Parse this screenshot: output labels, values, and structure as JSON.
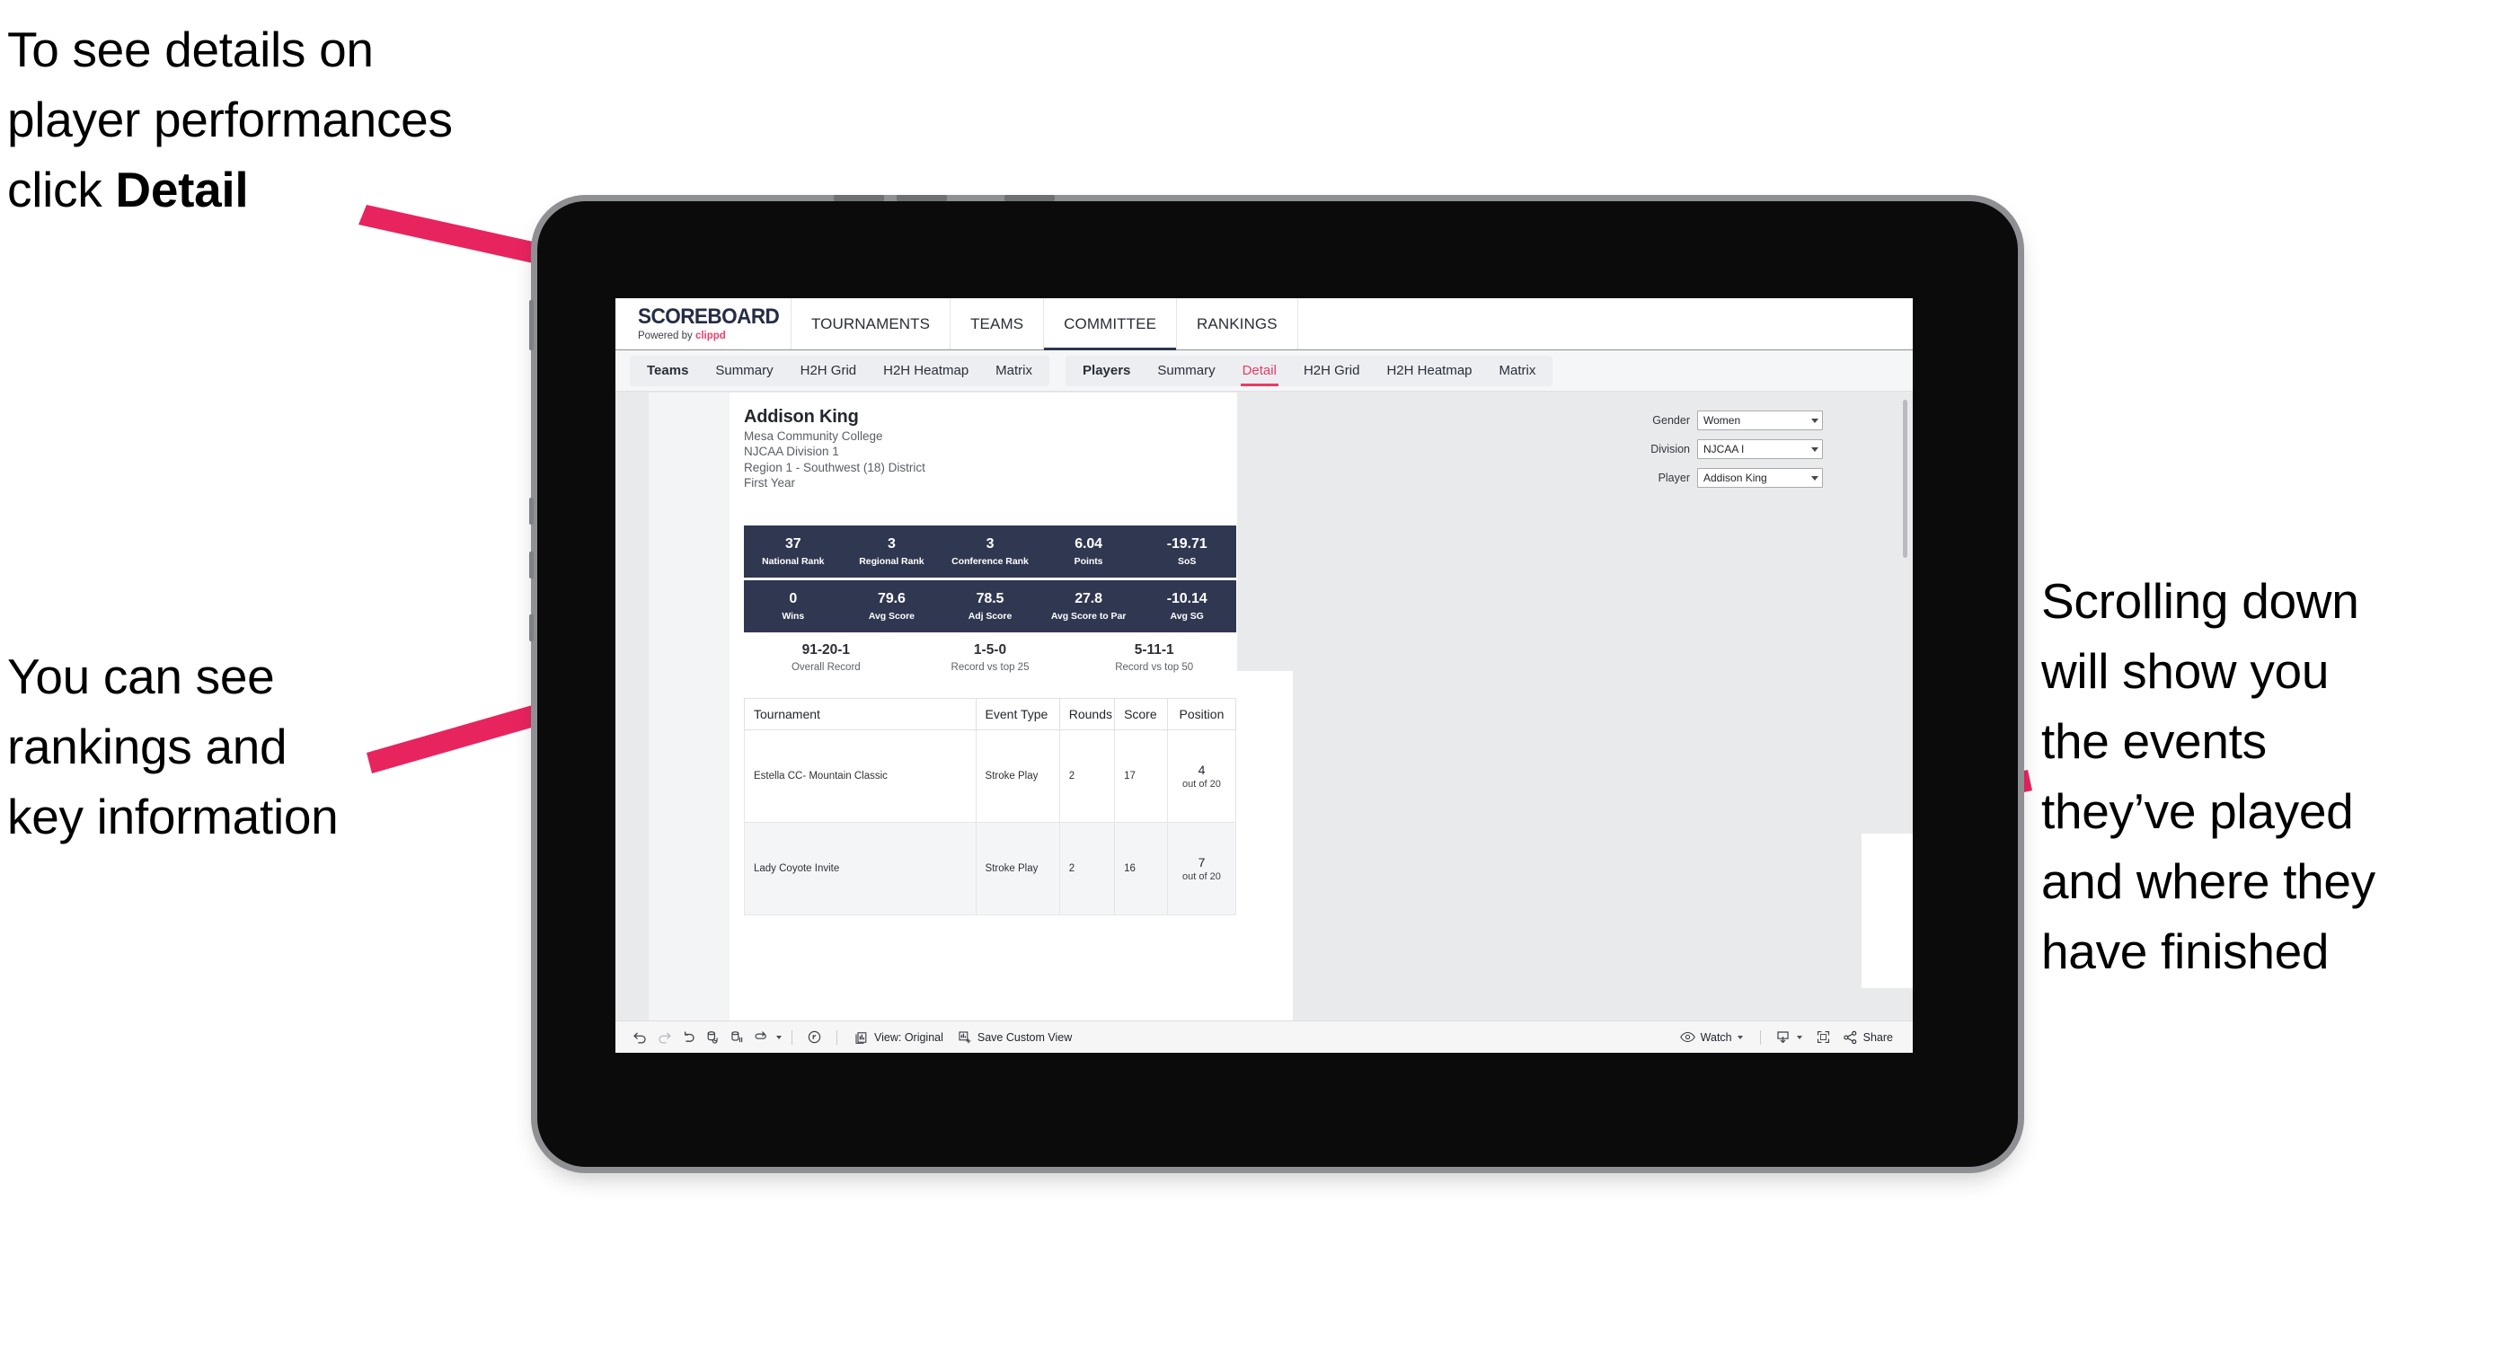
{
  "annotations": {
    "detail": "To see details on\nplayer performances\nclick ",
    "detail_bold": "Detail",
    "rankings": "You can see\nrankings and\nkey information",
    "scroll": "Scrolling down\nwill show you\nthe events\nthey’ve played\nand where they\nhave finished"
  },
  "brand": {
    "name": "SCOREBOARD",
    "tagline_prefix": "Powered by ",
    "tagline_brand": "clippd"
  },
  "topnav": {
    "items": [
      {
        "label": "TOURNAMENTS",
        "active": false
      },
      {
        "label": "TEAMS",
        "active": false
      },
      {
        "label": "COMMITTEE",
        "active": true
      },
      {
        "label": "RANKINGS",
        "active": false
      }
    ]
  },
  "subnav": {
    "group_teams": [
      {
        "label": "Teams",
        "bold": true,
        "active": false
      },
      {
        "label": "Summary",
        "bold": false,
        "active": false
      },
      {
        "label": "H2H Grid",
        "bold": false,
        "active": false
      },
      {
        "label": "H2H Heatmap",
        "bold": false,
        "active": false
      },
      {
        "label": "Matrix",
        "bold": false,
        "active": false
      }
    ],
    "group_players": [
      {
        "label": "Players",
        "bold": true,
        "active": false
      },
      {
        "label": "Summary",
        "bold": false,
        "active": false
      },
      {
        "label": "Detail",
        "bold": false,
        "active": true
      },
      {
        "label": "H2H Grid",
        "bold": false,
        "active": false
      },
      {
        "label": "H2H Heatmap",
        "bold": false,
        "active": false
      },
      {
        "label": "Matrix",
        "bold": false,
        "active": false
      }
    ]
  },
  "player": {
    "name": "Addison King",
    "school": "Mesa Community College",
    "division": "NJCAA Division 1",
    "region": "Region 1 - Southwest (18) District",
    "year": "First Year"
  },
  "filters": [
    {
      "label": "Gender",
      "value": "Women"
    },
    {
      "label": "Division",
      "value": "NJCAA I"
    },
    {
      "label": "Player",
      "value": "Addison King"
    }
  ],
  "stats_row1": [
    {
      "value": "37",
      "label": "National Rank"
    },
    {
      "value": "3",
      "label": "Regional Rank"
    },
    {
      "value": "3",
      "label": "Conference Rank"
    },
    {
      "value": "6.04",
      "label": "Points"
    },
    {
      "value": "-19.71",
      "label": "SoS"
    }
  ],
  "stats_row2": [
    {
      "value": "0",
      "label": "Wins"
    },
    {
      "value": "79.6",
      "label": "Avg Score"
    },
    {
      "value": "78.5",
      "label": "Adj Score"
    },
    {
      "value": "27.8",
      "label": "Avg Score to Par"
    },
    {
      "value": "-10.14",
      "label": "Avg SG"
    }
  ],
  "records": [
    {
      "value": "91-20-1",
      "label": "Overall Record"
    },
    {
      "value": "1-5-0",
      "label": "Record vs top 25"
    },
    {
      "value": "5-11-1",
      "label": "Record vs top 50"
    }
  ],
  "table": {
    "headers": [
      "Tournament",
      "Event Type",
      "Rounds",
      "Score",
      "Position"
    ],
    "rows": [
      {
        "tournament": "Estella CC- Mountain Classic",
        "event_type": "Stroke Play",
        "rounds": "2",
        "score": "17",
        "position": "4",
        "position_out_of": "out of 20"
      },
      {
        "tournament": "Lady Coyote Invite",
        "event_type": "Stroke Play",
        "rounds": "2",
        "score": "16",
        "position": "7",
        "position_out_of": "out of 20"
      }
    ]
  },
  "toolbar": {
    "view_label": "View: Original",
    "save_label": "Save Custom View",
    "watch_label": "Watch",
    "share_label": "Share"
  },
  "colors": {
    "accent_pink": "#ef3e6d",
    "arrow_pink": "#e8245f",
    "stat_navy": "#303750",
    "active_tab": "#e73b63"
  }
}
